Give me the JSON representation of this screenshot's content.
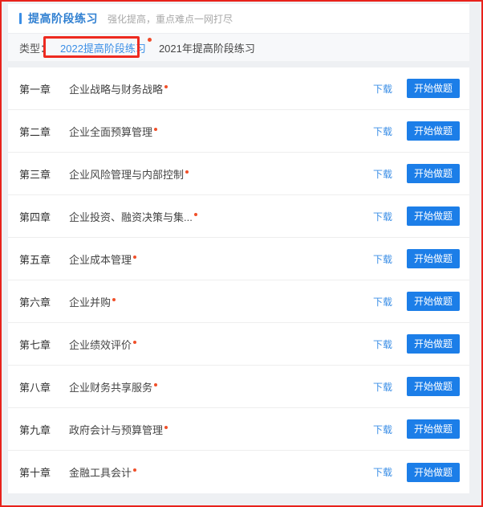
{
  "header": {
    "title": "提高阶段练习",
    "subtitle": "强化提高，重点难点一网打尽",
    "accent_color": "#3a8ee6"
  },
  "filter": {
    "label": "类型：",
    "tabs": [
      {
        "label": "2022提高阶段练习",
        "active": true,
        "badge": true
      },
      {
        "label": "2021年提高阶段练习",
        "active": false,
        "badge": false
      }
    ],
    "highlight_color": "#ee2a20"
  },
  "list": {
    "download_label": "下载",
    "start_label": "开始做题",
    "button_color": "#1c7ee8",
    "link_color": "#3a8ee6",
    "new_dot_color": "#f0502a",
    "rows": [
      {
        "index": "第一章",
        "name": "企业战略与财务战略",
        "is_new": true
      },
      {
        "index": "第二章",
        "name": "企业全面预算管理",
        "is_new": true
      },
      {
        "index": "第三章",
        "name": "企业风险管理与内部控制",
        "is_new": true
      },
      {
        "index": "第四章",
        "name": "企业投资、融资决策与集...",
        "is_new": true
      },
      {
        "index": "第五章",
        "name": "企业成本管理",
        "is_new": true
      },
      {
        "index": "第六章",
        "name": "企业并购",
        "is_new": true
      },
      {
        "index": "第七章",
        "name": "企业绩效评价",
        "is_new": true
      },
      {
        "index": "第八章",
        "name": "企业财务共享服务",
        "is_new": true
      },
      {
        "index": "第九章",
        "name": "政府会计与预算管理",
        "is_new": true
      },
      {
        "index": "第十章",
        "name": "金融工具会计",
        "is_new": true
      }
    ]
  }
}
